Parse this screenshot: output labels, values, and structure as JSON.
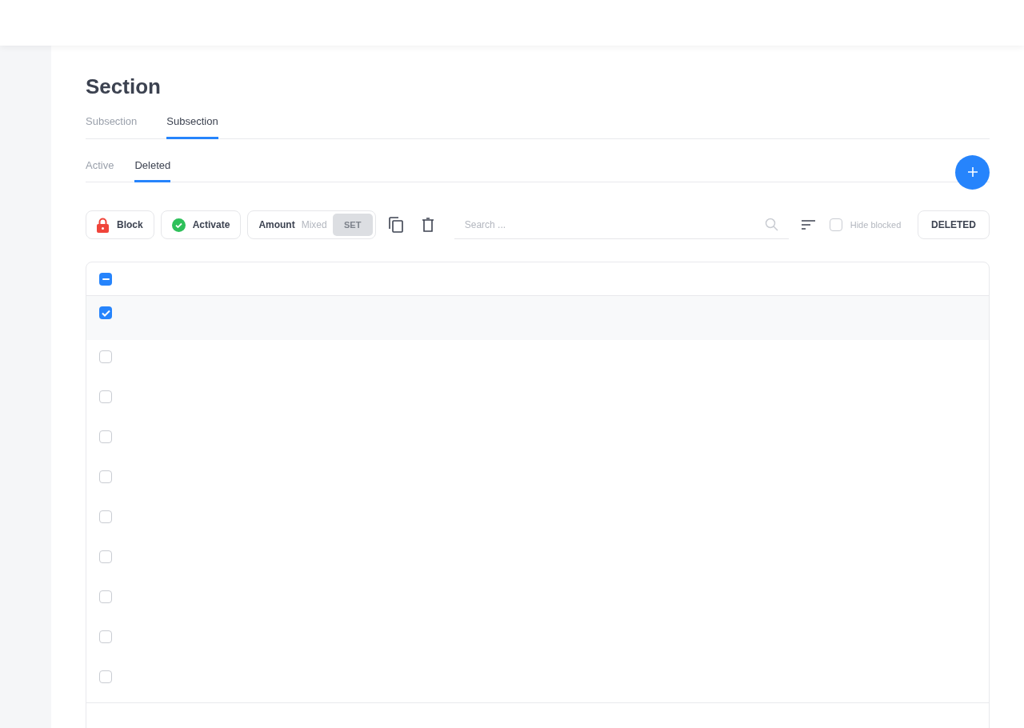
{
  "page": {
    "title": "Section"
  },
  "tabs": [
    {
      "label": "Subsection",
      "selected": false
    },
    {
      "label": "Subsection",
      "selected": true
    }
  ],
  "subtabs": [
    {
      "label": "Active",
      "selected": false
    },
    {
      "label": "Deleted",
      "selected": true
    }
  ],
  "toolbar": {
    "block_button": "Block",
    "activate_button": "Activate",
    "amount": {
      "label": "Amount",
      "value": "Mixed",
      "set_button": "SET",
      "disabled": true
    },
    "search": {
      "placeholder": "Search ..."
    },
    "hide_blocked": {
      "label": "Hide blocked",
      "checked": false
    },
    "filter_button": "DELETED"
  },
  "table": {
    "header_checkbox": {
      "indeterminate": true
    },
    "rows": [
      {
        "checked": true
      },
      {
        "checked": false
      },
      {
        "checked": false
      },
      {
        "checked": false
      },
      {
        "checked": false
      },
      {
        "checked": false
      },
      {
        "checked": false
      },
      {
        "checked": false
      },
      {
        "checked": false
      },
      {
        "checked": false
      }
    ]
  }
}
